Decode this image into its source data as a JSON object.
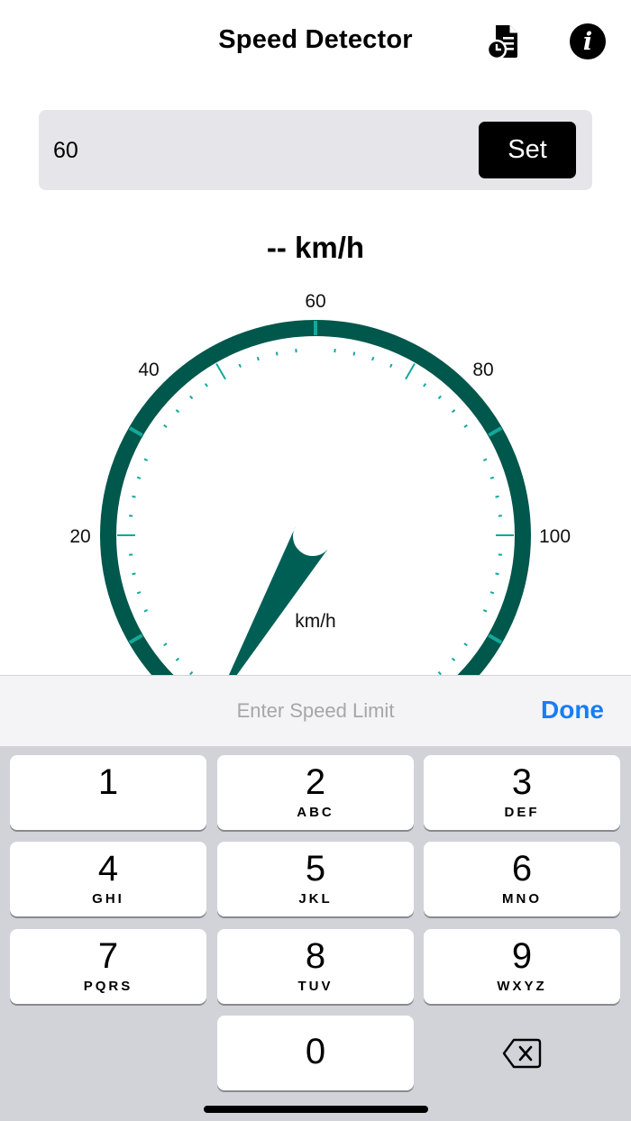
{
  "header": {
    "title": "Speed Detector",
    "history_icon": "document-clock-icon",
    "info_icon": "info-circle-icon",
    "info_glyph": "i"
  },
  "speed_limit": {
    "value": "60",
    "set_label": "Set"
  },
  "speed_readout": "-- km/h",
  "gauge": {
    "unit_label": "km/h",
    "tick_labels": [
      "20",
      "40",
      "60",
      "80",
      "100"
    ],
    "needle_value": 10,
    "colors": {
      "rim": "#00574b",
      "ticks": "#14a89a",
      "needle": "#005f55"
    }
  },
  "keyboard": {
    "accessory_placeholder": "Enter Speed Limit",
    "done_label": "Done",
    "keys": [
      {
        "num": "1",
        "letters": ""
      },
      {
        "num": "2",
        "letters": "ABC"
      },
      {
        "num": "3",
        "letters": "DEF"
      },
      {
        "num": "4",
        "letters": "GHI"
      },
      {
        "num": "5",
        "letters": "JKL"
      },
      {
        "num": "6",
        "letters": "MNO"
      },
      {
        "num": "7",
        "letters": "PQRS"
      },
      {
        "num": "8",
        "letters": "TUV"
      },
      {
        "num": "9",
        "letters": "WXYZ"
      },
      {
        "num": "0",
        "letters": ""
      }
    ],
    "delete_icon": "backspace-icon"
  }
}
